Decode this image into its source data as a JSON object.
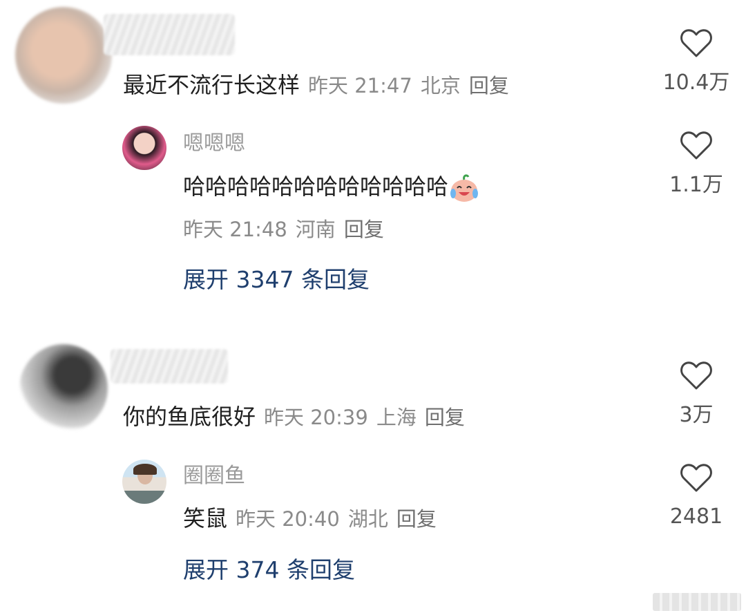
{
  "comments": [
    {
      "text": "最近不流行长这样",
      "time": "昨天 21:47",
      "location": "北京",
      "reply_label": "回复",
      "likes": "10.4万",
      "reply": {
        "username": "嗯嗯嗯",
        "text": "哈哈哈哈哈哈哈哈哈哈哈哈",
        "emoji": "laughing-crying-emoji",
        "time": "昨天 21:48",
        "location": "河南",
        "reply_label": "回复",
        "likes": "1.1万"
      },
      "expand": "展开 3347 条回复"
    },
    {
      "text": "你的鱼底很好",
      "time": "昨天 20:39",
      "location": "上海",
      "reply_label": "回复",
      "likes": "3万",
      "reply": {
        "username": "圈圈鱼",
        "text": "笑鼠",
        "time": "昨天 20:40",
        "location": "湖北",
        "reply_label": "回复",
        "likes": "2481"
      },
      "expand": "展开 374 条回复"
    }
  ],
  "icons": {
    "like": "heart-outline-icon"
  },
  "colors": {
    "expand_link": "#1f3f6e",
    "meta": "#8a8a8a",
    "text": "#1f1f1f"
  }
}
